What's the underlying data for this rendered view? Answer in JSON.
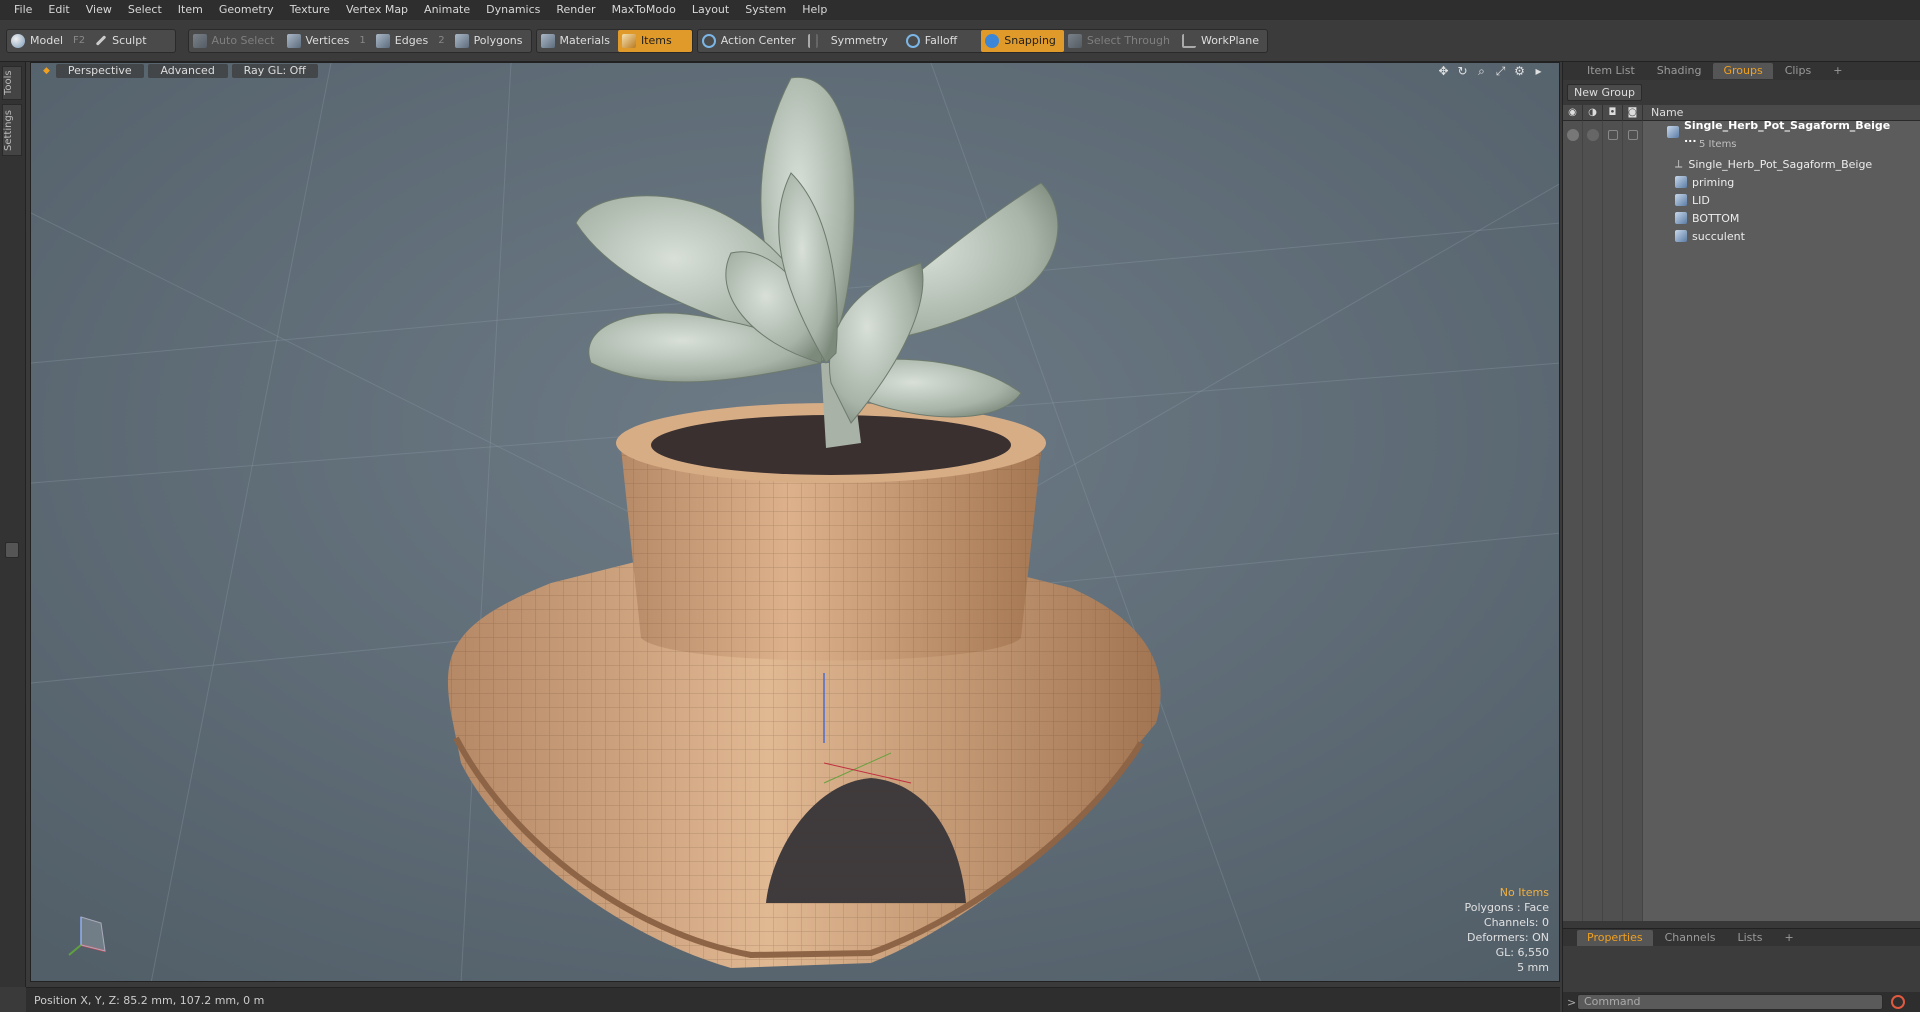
{
  "menu": [
    "File",
    "Edit",
    "View",
    "Select",
    "Item",
    "Geometry",
    "Texture",
    "Vertex Map",
    "Animate",
    "Dynamics",
    "Render",
    "MaxToModo",
    "Layout",
    "System",
    "Help"
  ],
  "toolbar": {
    "model": "Model",
    "model_key": "F2",
    "sculpt": "Sculpt",
    "auto_select": "Auto Select",
    "vertices": "Vertices",
    "vertices_key": "1",
    "edges": "Edges",
    "edges_key": "2",
    "polygons": "Polygons",
    "materials": "Materials",
    "items": "Items",
    "action_center": "Action Center",
    "symmetry": "Symmetry",
    "falloff": "Falloff",
    "snapping": "Snapping",
    "select_through": "Select Through",
    "workplane": "WorkPlane"
  },
  "left_tabs": {
    "tools": "Tools",
    "settings": "Settings"
  },
  "viewport": {
    "view": "Perspective",
    "mode": "Advanced",
    "raygl": "Ray GL: Off",
    "stats": {
      "items": "No Items",
      "polygons": "Polygons : Face",
      "channels": "Channels: 0",
      "deformers": "Deformers: ON",
      "gl": "GL: 6,550",
      "scale": "5 mm"
    }
  },
  "status": {
    "position": "Position X, Y, Z:  85.2 mm, 107.2 mm, 0 m"
  },
  "panel": {
    "tabs": [
      "Item List",
      "Shading",
      "Groups",
      "Clips",
      "+"
    ],
    "new_group": "New Group",
    "name_header": "Name",
    "root": "Single_Herb_Pot_Sagaform_Beige ...",
    "root_sub": "5 Items",
    "children": [
      "Single_Herb_Pot_Sagaform_Beige",
      "priming",
      "LID",
      "BOTTOM",
      "succulent"
    ],
    "bottom_tabs": [
      "Properties",
      "Channels",
      "Lists",
      "+"
    ],
    "command_placeholder": "Command"
  },
  "colors": {
    "accent": "#e09a2a",
    "viewport_bg": "#5a6873",
    "pot": "#c89a72"
  }
}
